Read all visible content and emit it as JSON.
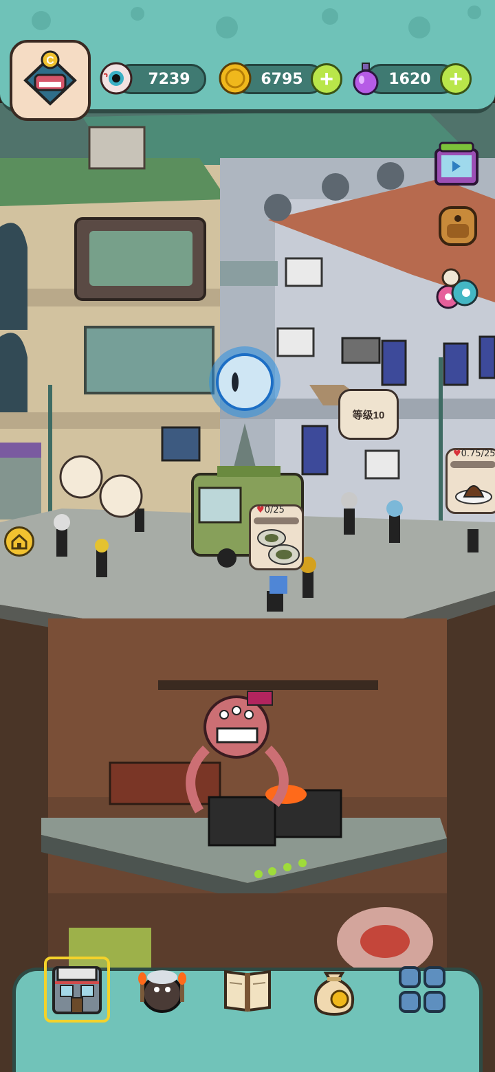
{
  "resources": {
    "eyes": {
      "icon": "eyeball-icon",
      "value": "7239"
    },
    "coins": {
      "icon": "coin-icon",
      "value": "6795"
    },
    "potions": {
      "icon": "potion-icon",
      "value": "1620"
    }
  },
  "avatar": {
    "letter": "C"
  },
  "scene": {
    "level_bubble": "等级10",
    "food_truck_order": {
      "hearts": "0/25"
    },
    "right_shop_order": {
      "hearts": "0.75/25"
    }
  },
  "side_icons": [
    "tv-ads-icon",
    "backpack-icon",
    "monster-eggs-icon"
  ],
  "bottom_nav": [
    {
      "name": "nav-restaurant",
      "icon": "restaurant-icon",
      "active": true
    },
    {
      "name": "nav-monster",
      "icon": "monster-icon",
      "active": false
    },
    {
      "name": "nav-recipe-book",
      "icon": "book-icon",
      "active": false
    },
    {
      "name": "nav-money-bag",
      "icon": "money-bag-icon",
      "active": false
    },
    {
      "name": "nav-menu",
      "icon": "grid-menu-icon",
      "active": false
    }
  ],
  "colors": {
    "teal": "#6fc2b8",
    "plus_green": "#b9e64a",
    "home_yellow": "#f2c230"
  }
}
